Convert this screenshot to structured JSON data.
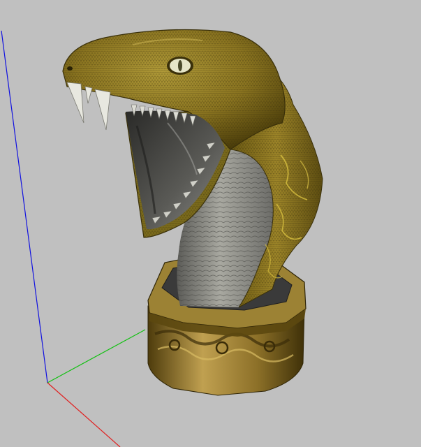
{
  "viewport": {
    "background_color": "#c0c0c0",
    "axis_colors": {
      "x": "#e02020",
      "y": "#10c010",
      "z": "#1010e0"
    }
  },
  "model": {
    "subject": "cobra-statue-on-pedestal",
    "colors": {
      "scales_dark": "#5a4a0e",
      "scales_mid": "#8a7420",
      "scales_light": "#b09a38",
      "belly_dark": "#5c5c58",
      "belly_light": "#a8a8a0",
      "mouth_dark": "#2e2e2c",
      "mouth_light": "#8a8a86",
      "fang": "#e8e8e0",
      "eye": "#e6e6c8",
      "gold_dark": "#4e3c0c",
      "gold_mid": "#8c7028",
      "gold_light": "#c0a050",
      "base_top": "#3a3a3a"
    }
  }
}
